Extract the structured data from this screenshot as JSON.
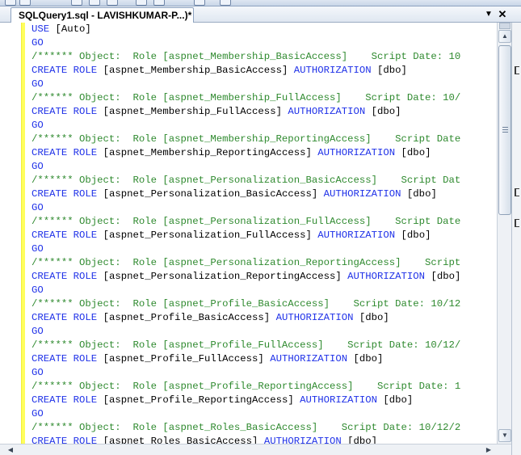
{
  "tab": {
    "title": "SQLQuery1.sql - LAVISHKUMAR-P...)*",
    "dropdown_glyph": "▼",
    "close_glyph": "✕"
  },
  "code_lines": [
    [
      {
        "c": "kw",
        "t": "USE"
      },
      {
        "c": "txt",
        "t": " [Auto]"
      }
    ],
    [
      {
        "c": "kw",
        "t": "GO"
      }
    ],
    [
      {
        "c": "cmt",
        "t": "/****** Object:  Role [aspnet_Membership_BasicAccess]    Script Date: 10"
      }
    ],
    [
      {
        "c": "kw",
        "t": "CREATE ROLE"
      },
      {
        "c": "txt",
        "t": " [aspnet_Membership_BasicAccess] "
      },
      {
        "c": "kw",
        "t": "AUTHORIZATION"
      },
      {
        "c": "txt",
        "t": " [dbo]"
      }
    ],
    [
      {
        "c": "kw",
        "t": "GO"
      }
    ],
    [
      {
        "c": "cmt",
        "t": "/****** Object:  Role [aspnet_Membership_FullAccess]    Script Date: 10/"
      }
    ],
    [
      {
        "c": "kw",
        "t": "CREATE ROLE"
      },
      {
        "c": "txt",
        "t": " [aspnet_Membership_FullAccess] "
      },
      {
        "c": "kw",
        "t": "AUTHORIZATION"
      },
      {
        "c": "txt",
        "t": " [dbo]"
      }
    ],
    [
      {
        "c": "kw",
        "t": "GO"
      }
    ],
    [
      {
        "c": "cmt",
        "t": "/****** Object:  Role [aspnet_Membership_ReportingAccess]    Script Date"
      }
    ],
    [
      {
        "c": "kw",
        "t": "CREATE ROLE"
      },
      {
        "c": "txt",
        "t": " [aspnet_Membership_ReportingAccess] "
      },
      {
        "c": "kw",
        "t": "AUTHORIZATION"
      },
      {
        "c": "txt",
        "t": " [dbo]"
      }
    ],
    [
      {
        "c": "kw",
        "t": "GO"
      }
    ],
    [
      {
        "c": "cmt",
        "t": "/****** Object:  Role [aspnet_Personalization_BasicAccess]    Script Dat"
      }
    ],
    [
      {
        "c": "kw",
        "t": "CREATE ROLE"
      },
      {
        "c": "txt",
        "t": " [aspnet_Personalization_BasicAccess] "
      },
      {
        "c": "kw",
        "t": "AUTHORIZATION"
      },
      {
        "c": "txt",
        "t": " [dbo]"
      }
    ],
    [
      {
        "c": "kw",
        "t": "GO"
      }
    ],
    [
      {
        "c": "cmt",
        "t": "/****** Object:  Role [aspnet_Personalization_FullAccess]    Script Date"
      }
    ],
    [
      {
        "c": "kw",
        "t": "CREATE ROLE"
      },
      {
        "c": "txt",
        "t": " [aspnet_Personalization_FullAccess] "
      },
      {
        "c": "kw",
        "t": "AUTHORIZATION"
      },
      {
        "c": "txt",
        "t": " [dbo]"
      }
    ],
    [
      {
        "c": "kw",
        "t": "GO"
      }
    ],
    [
      {
        "c": "cmt",
        "t": "/****** Object:  Role [aspnet_Personalization_ReportingAccess]    Script"
      }
    ],
    [
      {
        "c": "kw",
        "t": "CREATE ROLE"
      },
      {
        "c": "txt",
        "t": " [aspnet_Personalization_ReportingAccess] "
      },
      {
        "c": "kw",
        "t": "AUTHORIZATION"
      },
      {
        "c": "txt",
        "t": " [dbo]"
      }
    ],
    [
      {
        "c": "kw",
        "t": "GO"
      }
    ],
    [
      {
        "c": "cmt",
        "t": "/****** Object:  Role [aspnet_Profile_BasicAccess]    Script Date: 10/12"
      }
    ],
    [
      {
        "c": "kw",
        "t": "CREATE ROLE"
      },
      {
        "c": "txt",
        "t": " [aspnet_Profile_BasicAccess] "
      },
      {
        "c": "kw",
        "t": "AUTHORIZATION"
      },
      {
        "c": "txt",
        "t": " [dbo]"
      }
    ],
    [
      {
        "c": "kw",
        "t": "GO"
      }
    ],
    [
      {
        "c": "cmt",
        "t": "/****** Object:  Role [aspnet_Profile_FullAccess]    Script Date: 10/12/"
      }
    ],
    [
      {
        "c": "kw",
        "t": "CREATE ROLE"
      },
      {
        "c": "txt",
        "t": " [aspnet_Profile_FullAccess] "
      },
      {
        "c": "kw",
        "t": "AUTHORIZATION"
      },
      {
        "c": "txt",
        "t": " [dbo]"
      }
    ],
    [
      {
        "c": "kw",
        "t": "GO"
      }
    ],
    [
      {
        "c": "cmt",
        "t": "/****** Object:  Role [aspnet_Profile_ReportingAccess]    Script Date: 1"
      }
    ],
    [
      {
        "c": "kw",
        "t": "CREATE ROLE"
      },
      {
        "c": "txt",
        "t": " [aspnet_Profile_ReportingAccess] "
      },
      {
        "c": "kw",
        "t": "AUTHORIZATION"
      },
      {
        "c": "txt",
        "t": " [dbo]"
      }
    ],
    [
      {
        "c": "kw",
        "t": "GO"
      }
    ],
    [
      {
        "c": "cmt",
        "t": "/****** Object:  Role [aspnet_Roles_BasicAccess]    Script Date: 10/12/2"
      }
    ],
    [
      {
        "c": "kw",
        "t": "CREATE ROLE"
      },
      {
        "c": "txt",
        "t": " [aspnet_Roles_BasicAccess] "
      },
      {
        "c": "kw",
        "t": "AUTHORIZATION"
      },
      {
        "c": "txt",
        "t": " [dbo]"
      }
    ]
  ],
  "syntax_colors": {
    "keyword": "#1f31e8",
    "comment": "#2f8a2f",
    "text": "#000000",
    "change_bar": "#fffe5c"
  },
  "icons": {
    "dropdown": "chevron-down-icon",
    "close": "close-icon",
    "scroll_up": "arrow-up-icon",
    "scroll_down": "arrow-down-icon",
    "scroll_left": "arrow-left-icon",
    "scroll_right": "arrow-right-icon"
  }
}
